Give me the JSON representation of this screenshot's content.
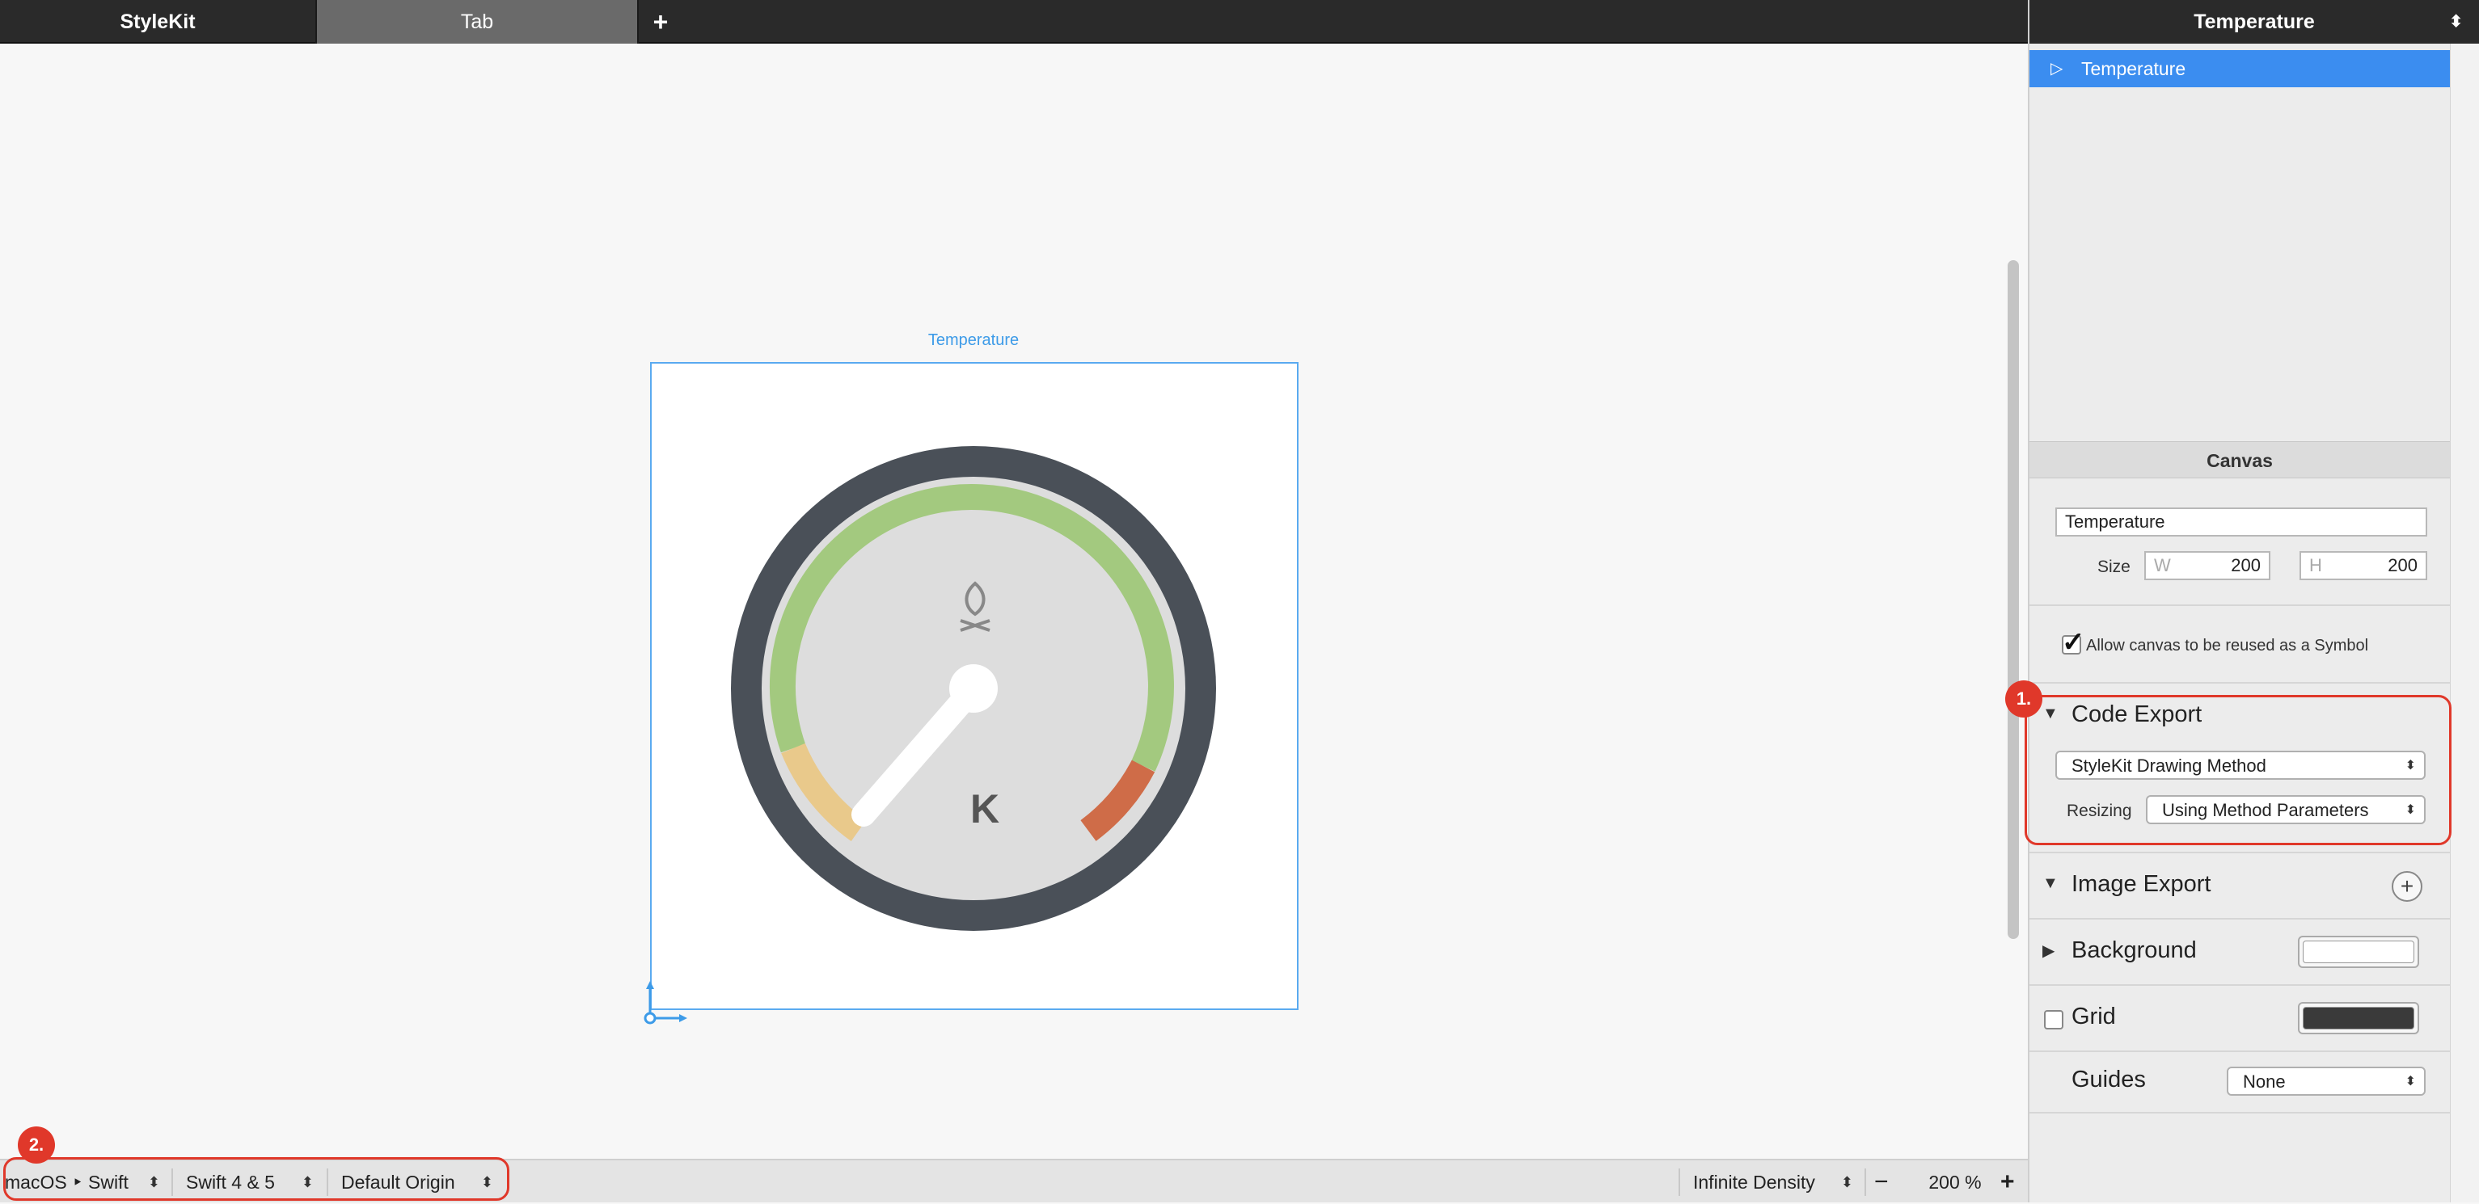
{
  "app": {
    "title": "StyleKit",
    "tab_label": "Tab",
    "add_tab_label": "+"
  },
  "canvas": {
    "name_label": "Temperature",
    "gauge_unit": "K"
  },
  "bottom_bar": {
    "platform": "macOS ‣ Swift",
    "language_version": "Swift 4 & 5",
    "origin": "Default Origin",
    "density": "Infinite Density",
    "zoom_minus": "−",
    "zoom_value": "200 %",
    "zoom_plus": "+",
    "arrows": "⬍"
  },
  "annotations": {
    "badge_1": "1.",
    "badge_2": "2."
  },
  "inspector": {
    "header_title": "Temperature",
    "header_arrows": "⬍",
    "outline": {
      "selected_item": "Temperature",
      "selected_icon": "▷"
    },
    "canvas_section": {
      "title": "Canvas",
      "name_value": "Temperature",
      "size_label": "Size",
      "width_prefix": "W",
      "width_value": "200",
      "height_prefix": "H",
      "height_value": "200",
      "reuse_checkbox_label": "Allow canvas to be reused as a Symbol",
      "reuse_checked": true
    },
    "code_export": {
      "title": "Code Export",
      "method_value": "StyleKit Drawing Method",
      "resizing_label": "Resizing",
      "resizing_value": "Using Method Parameters"
    },
    "image_export": {
      "title": "Image Export",
      "add_label": "+"
    },
    "background": {
      "title": "Background",
      "color": "#ffffff"
    },
    "grid": {
      "title": "Grid",
      "enabled": false,
      "color": "#3a3a3a"
    },
    "guides": {
      "title": "Guides",
      "value": "None"
    }
  },
  "colors": {
    "accent_blue": "#3b8df0",
    "annotation_red": "#e0382a",
    "gauge_ring": "#4a5058",
    "gauge_face": "#dddddd",
    "gauge_green": "#a3c97f",
    "gauge_yellow": "#e9c98b",
    "gauge_red": "#cf6c48"
  }
}
